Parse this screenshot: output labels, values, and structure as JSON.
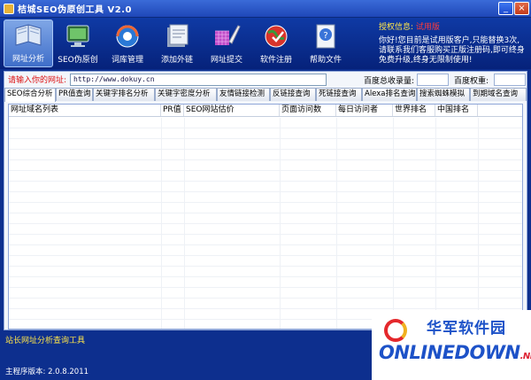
{
  "window": {
    "title": "桔城SEO伪原创工具 V2.0"
  },
  "toolbar": {
    "items": [
      {
        "label": "网址分析",
        "icon": "book-icon",
        "active": true
      },
      {
        "label": "SEO伪原创",
        "icon": "monitor-icon",
        "active": false
      },
      {
        "label": "词库管理",
        "icon": "support-globe-icon",
        "active": false
      },
      {
        "label": "添加外链",
        "icon": "document-stack-icon",
        "active": false
      },
      {
        "label": "网址提交",
        "icon": "paint-brush-icon",
        "active": false
      },
      {
        "label": "软件注册",
        "icon": "globe-icon",
        "active": false
      },
      {
        "label": "帮助文件",
        "icon": "help-document-icon",
        "active": false
      }
    ]
  },
  "auth": {
    "title": "授权信息:",
    "status": "试用版",
    "message": "你好!您目前是试用版客户,只能替换3次,请联系我们客服购买正版注册码,即可终身免费升级,终身无限制使用!"
  },
  "url_bar": {
    "label": "请输入你的网址:",
    "value": "http://www.dokuy.cn",
    "index_label": "百度总收录量:",
    "weight_label": "百度权重:"
  },
  "tabs": [
    "SEO综合分析",
    "PR值查询",
    "关键字排名分析",
    "关键字密度分析",
    "友情链接检测",
    "反链接查询",
    "死链接查询",
    "Alexa排名查询",
    "搜索蜘蛛模拟",
    "到期域名查询"
  ],
  "table": {
    "columns": [
      "网址域名列表",
      "PR值",
      "SEO网站估价",
      "页面访问数",
      "每日访问者",
      "世界排名",
      "中国排名"
    ]
  },
  "status": {
    "hint": "站长网址分析查询工具",
    "version": "主程序版本: 2.0.8.2011"
  },
  "watermark": {
    "cn": "华军软件园",
    "en": "ONLINEDOWN",
    "suffix": ".NET"
  },
  "colors": {
    "header_bg": "#0f3aa5",
    "accent_yellow": "#ffe54a",
    "alert_red": "#ff3b3b"
  }
}
